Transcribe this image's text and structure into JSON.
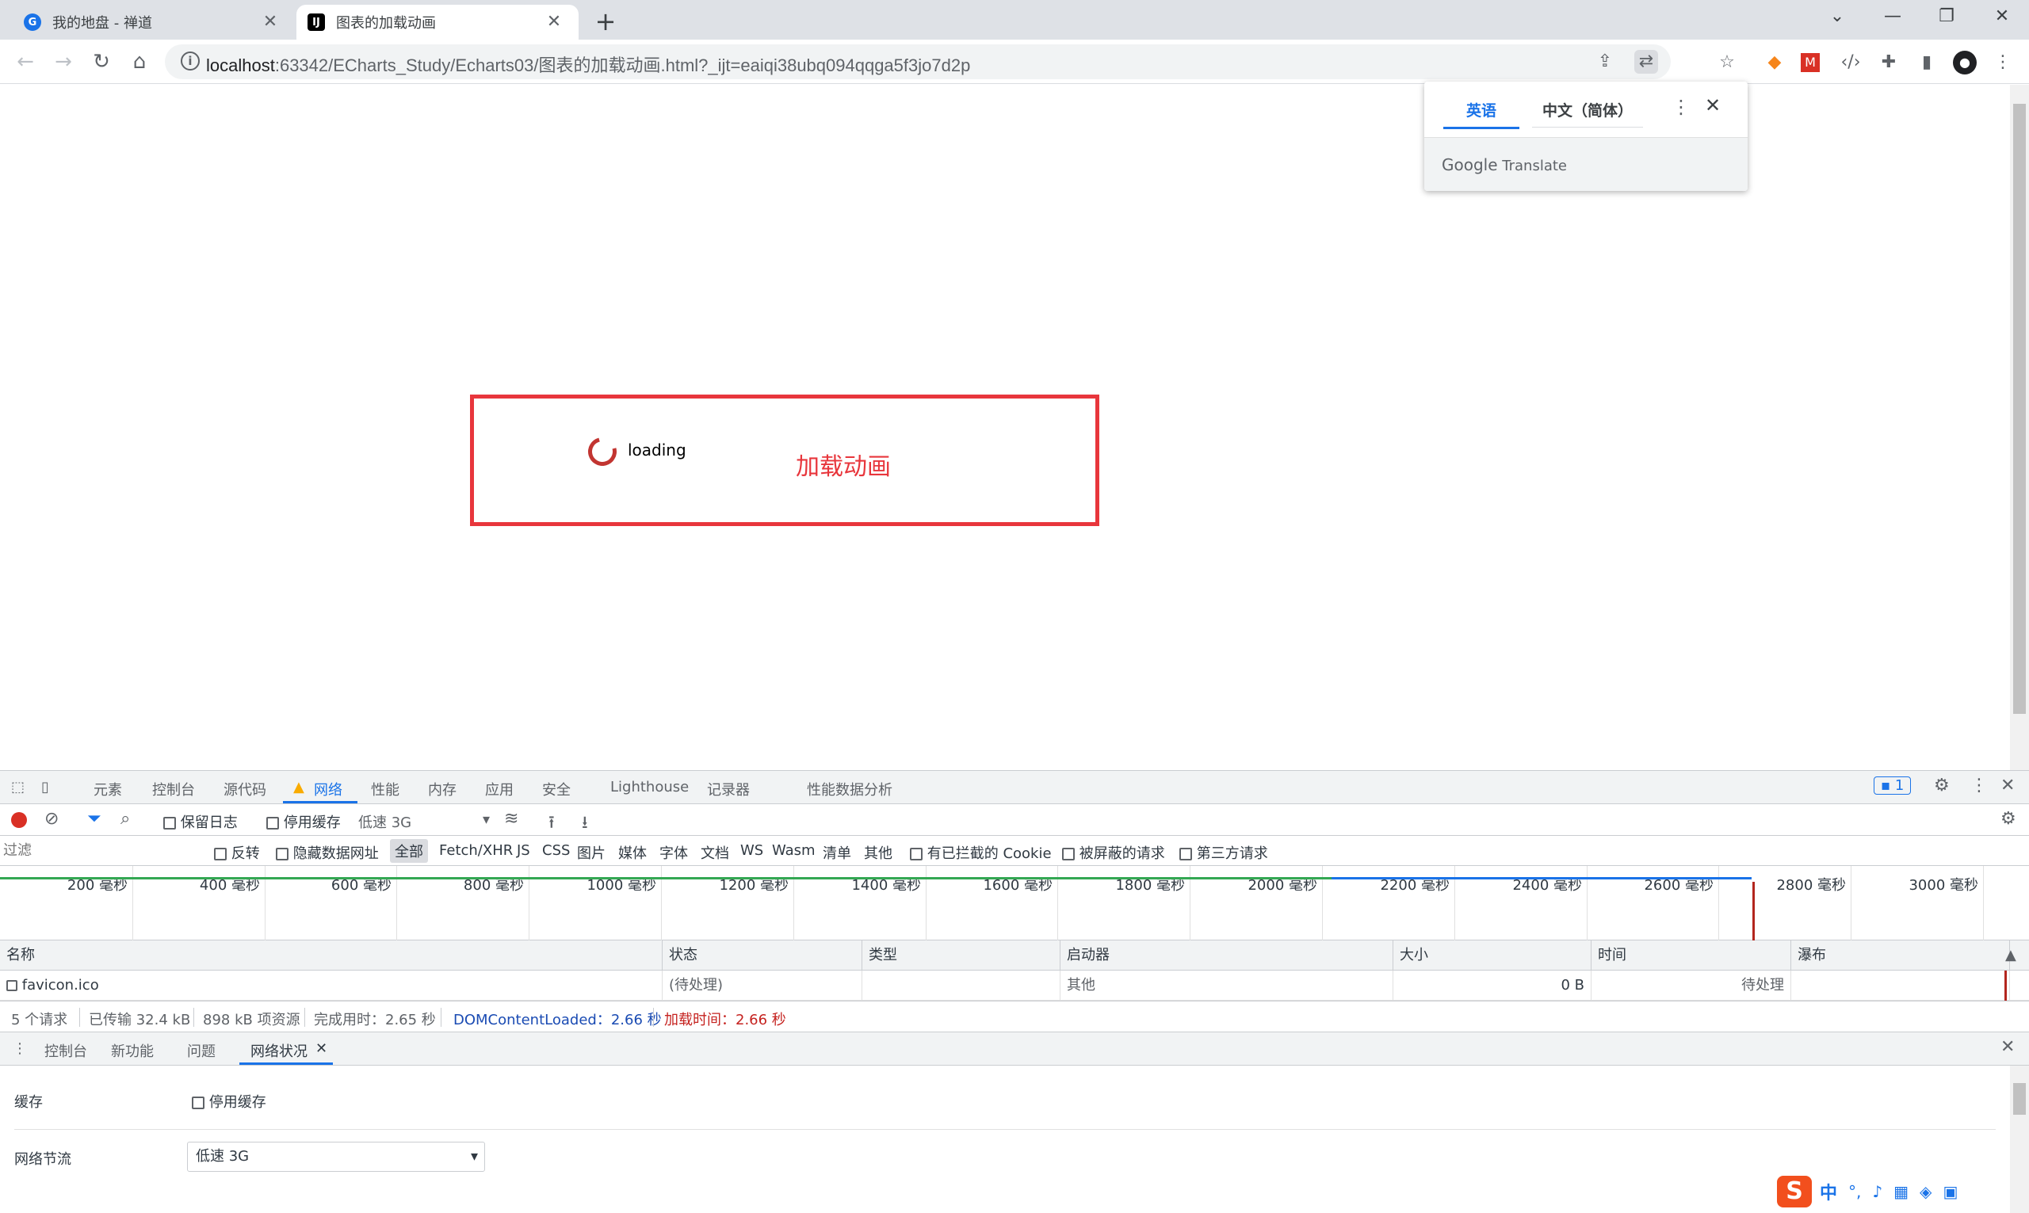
{
  "browser": {
    "tabs": [
      {
        "title": "我的地盘 - 禅道",
        "active": false
      },
      {
        "title": "图表的加载动画",
        "active": true
      }
    ],
    "address": {
      "host": "localhost",
      "rest": ":63342/ECharts_Study/Echarts03/图表的加载动画.html?_ijt=eaiqi38ubq094qqga5f3jo7d2p"
    }
  },
  "page": {
    "loading_text": "loading",
    "annotation": "加载动画",
    "accent": "#e8363c",
    "spinner_color": "#c23531"
  },
  "translate": {
    "source_lang": "英语",
    "target_lang": "中文（简体）",
    "footer_brand": "Google",
    "footer_product": "Translate"
  },
  "devtools": {
    "tabs": [
      "元素",
      "控制台",
      "源代码",
      "网络",
      "性能",
      "内存",
      "应用",
      "安全",
      "Lighthouse",
      "记录器",
      "性能数据分析"
    ],
    "selected_tab": "网络",
    "issues_count": "1",
    "toolbar": {
      "preserve_log": "保留日志",
      "disable_cache": "停用缓存",
      "throttle": "低速 3G"
    },
    "filter": {
      "placeholder": "过滤",
      "invert": "反转",
      "hide_data_urls": "隐藏数据网址",
      "types": [
        "全部",
        "Fetch/XHR",
        "JS",
        "CSS",
        "图片",
        "媒体",
        "字体",
        "文档",
        "WS",
        "Wasm",
        "清单",
        "其他"
      ],
      "blocked_cookies": "有已拦截的 Cookie",
      "blocked_requests": "被屏蔽的请求",
      "third_party": "第三方请求"
    },
    "timeline_ticks": [
      "200 毫秒",
      "400 毫秒",
      "600 毫秒",
      "800 毫秒",
      "1000 毫秒",
      "1200 毫秒",
      "1400 毫秒",
      "1600 毫秒",
      "1800 毫秒",
      "2000 毫秒",
      "2200 毫秒",
      "2400 毫秒",
      "2600 毫秒",
      "2800 毫秒",
      "3000 毫秒"
    ],
    "columns": [
      "名称",
      "状态",
      "类型",
      "启动器",
      "大小",
      "时间",
      "瀑布"
    ],
    "rows": [
      {
        "name": "favicon.ico",
        "status": "(待处理)",
        "type": "",
        "initiator": "其他",
        "size": "0 B",
        "time": "待处理"
      }
    ],
    "summary": {
      "requests": "5 个请求",
      "transferred": "已传输 32.4 kB",
      "resources": "898 kB 项资源",
      "finish": "完成用时：2.65 秒",
      "dcl": "DOMContentLoaded：2.66 秒",
      "load": "加载时间：2.66 秒"
    },
    "drawer_tabs": [
      "控制台",
      "新功能",
      "问题",
      "网络状况"
    ],
    "drawer_selected": "网络状况",
    "conditions": {
      "cache_label": "缓存",
      "cache_option": "停用缓存",
      "throttle_label": "网络节流",
      "throttle_value": "低速 3G"
    }
  },
  "ime": {
    "label": "中"
  }
}
